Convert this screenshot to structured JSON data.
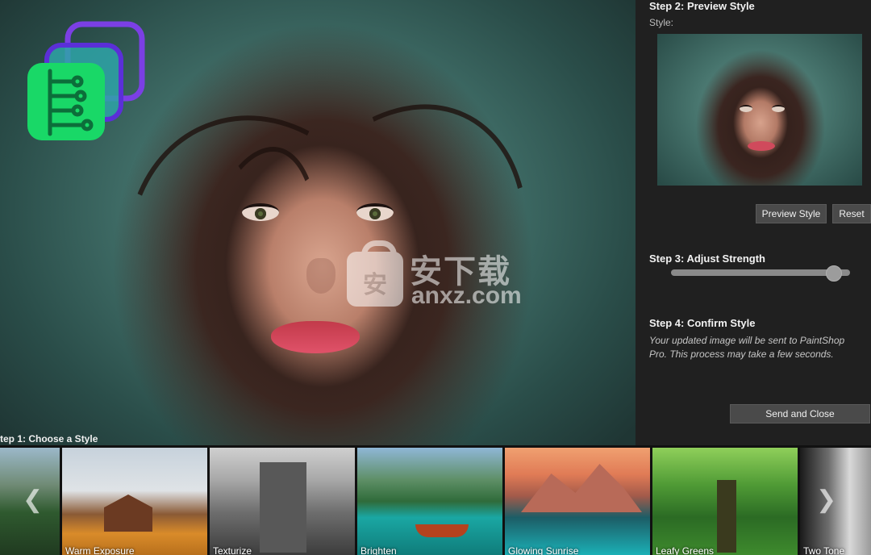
{
  "right_panel": {
    "step2_title": "Step 2: Preview Style",
    "style_label": "Style:",
    "preview_button": "Preview Style",
    "reset_button": "Reset",
    "step3_title": "Step 3: Adjust Strength",
    "strength_value": 0.95,
    "step4_title": "Step 4: Confirm Style",
    "confirm_description": "Your updated image will be sent to PaintShop Pro. This process may take a few seconds.",
    "send_button": "Send and Close"
  },
  "style_strip": {
    "title": "tep 1: Choose a Style",
    "prev_icon": "chevron-left-icon",
    "next_icon": "chevron-right-icon",
    "styles": [
      {
        "name": ""
      },
      {
        "name": "Warm Exposure"
      },
      {
        "name": "Texturize"
      },
      {
        "name": "Brighten"
      },
      {
        "name": "Glowing Sunrise"
      },
      {
        "name": "Leafy Greens"
      },
      {
        "name": "Two Tone"
      }
    ]
  },
  "watermark": {
    "main": "安下载",
    "sub": "anxz.com",
    "badge": "安"
  },
  "colors": {
    "logo_green": "#19d867",
    "logo_purple": "#7b3fe4",
    "button_bg": "#4a4a4a",
    "panel_bg": "#202020"
  }
}
